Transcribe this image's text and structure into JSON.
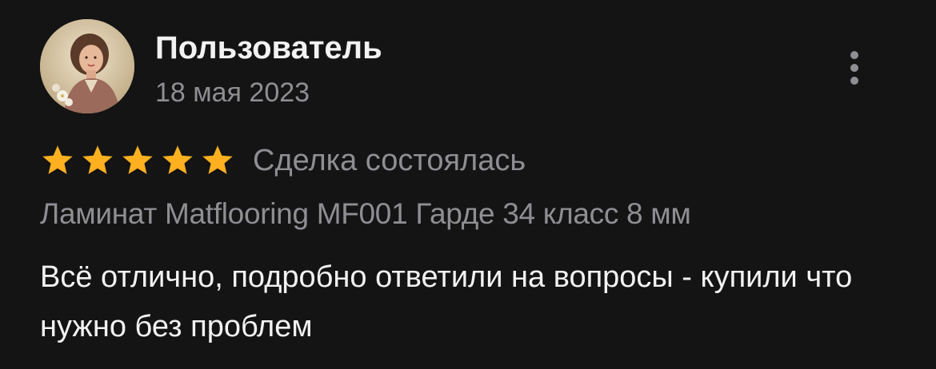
{
  "review": {
    "author": "Пользователь",
    "date": "18 мая 2023",
    "rating": 5,
    "rating_max": 5,
    "deal_status": "Сделка состоялась",
    "product": "Ламинат Matflooring MF001 Гарде 34 класс 8 мм",
    "text": "Всё отлично, подробно ответили на вопросы - купили что нужно без проблем"
  },
  "colors": {
    "star": "#FFB020",
    "background": "#141414",
    "primary_text": "#F2F2F2",
    "secondary_text": "#8E8E93"
  },
  "icons": {
    "avatar": "user-photo-avatar",
    "more": "more-vertical-icon",
    "star": "star-icon"
  }
}
